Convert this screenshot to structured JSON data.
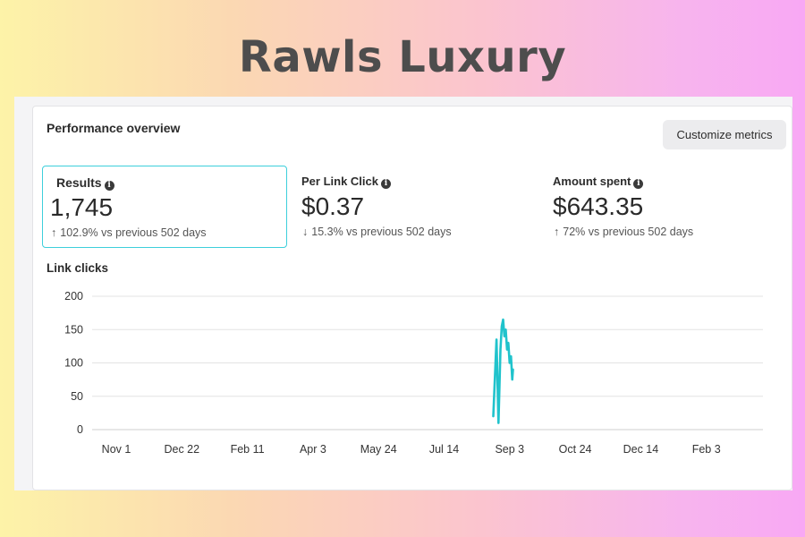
{
  "brand": {
    "title": "Rawls Luxury"
  },
  "panel": {
    "title": "Performance overview",
    "customize_label": "Customize metrics"
  },
  "metrics": [
    {
      "label": "Results",
      "value": "1,745",
      "delta": "102.9% vs previous 502 days",
      "direction": "up",
      "selected": true
    },
    {
      "label": "Per Link Click",
      "value": "$0.37",
      "delta": "15.3% vs previous 502 days",
      "direction": "down",
      "selected": false
    },
    {
      "label": "Amount spent",
      "value": "$643.35",
      "delta": "72% vs previous 502 days",
      "direction": "up",
      "selected": false
    }
  ],
  "icons": {
    "info": "info-icon",
    "up": "arrow-up-icon",
    "down": "arrow-down-icon"
  },
  "colors": {
    "accent": "#3dcfdb",
    "line": "#20c3cc"
  },
  "chart_data": {
    "type": "line",
    "title": "Link clicks",
    "xlabel": "",
    "ylabel": "",
    "ylim": [
      0,
      200
    ],
    "yticks": [
      0,
      50,
      100,
      150,
      200
    ],
    "x_tick_labels": [
      "Nov 1",
      "Dec 22",
      "Feb 11",
      "Apr 3",
      "May 24",
      "Jul 14",
      "Sep 3",
      "Oct 24",
      "Dec 14",
      "Feb 3"
    ],
    "grid": true,
    "legend": "none",
    "series": [
      {
        "values_by_tick_offset": [
          [
            5.75,
            20
          ],
          [
            5.8,
            135
          ],
          [
            5.83,
            10
          ],
          [
            5.86,
            120
          ],
          [
            5.88,
            155
          ],
          [
            5.9,
            165
          ],
          [
            5.92,
            140
          ],
          [
            5.94,
            150
          ],
          [
            5.96,
            120
          ],
          [
            5.98,
            130
          ],
          [
            6.0,
            100
          ],
          [
            6.02,
            110
          ],
          [
            6.04,
            75
          ],
          [
            6.05,
            90
          ]
        ]
      }
    ]
  }
}
